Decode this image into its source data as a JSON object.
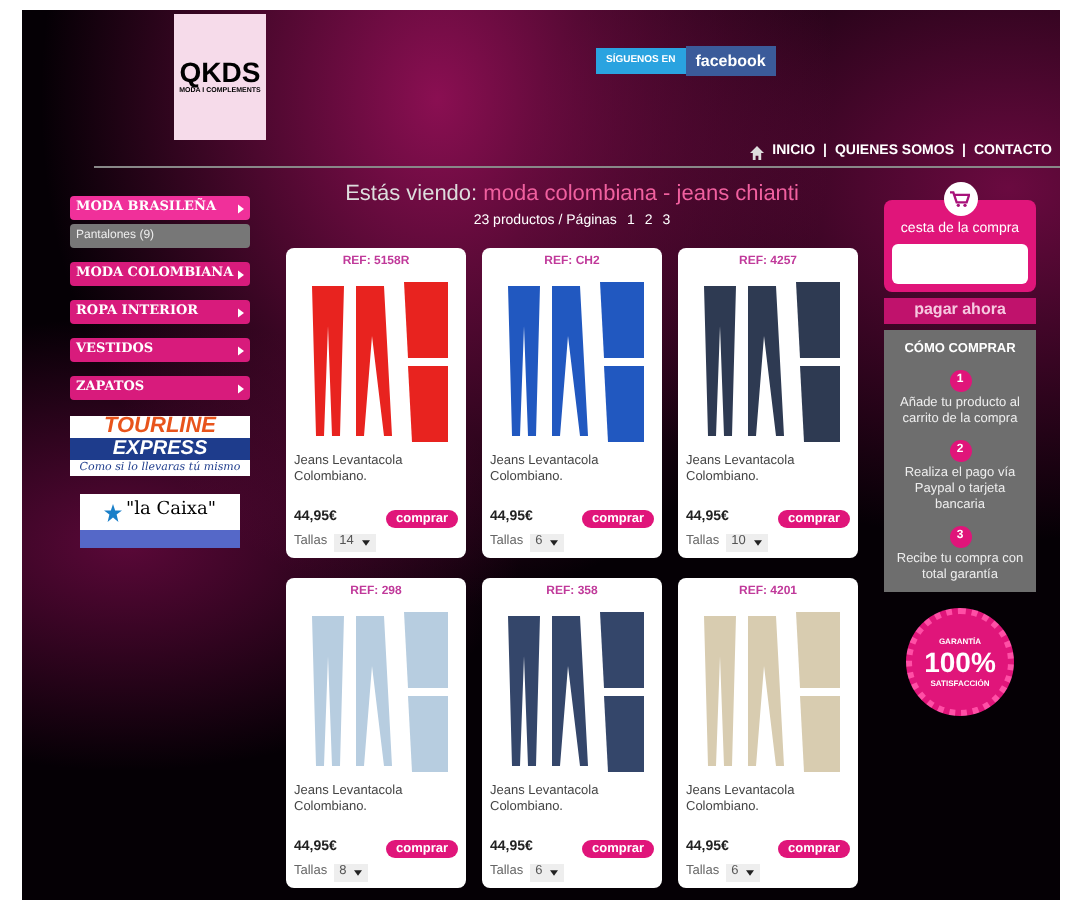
{
  "logo": {
    "name": "QKDS",
    "tagline": "MODA I COMPLEMENTS"
  },
  "social": {
    "label": "SÍGUENOS EN",
    "brand": "facebook"
  },
  "nav": [
    {
      "label": "INICIO",
      "kind": "home"
    },
    {
      "label": "QUIENES SOMOS",
      "kind": "link",
      "prefix": "|"
    },
    {
      "label": "CONTACTO",
      "kind": "link",
      "prefix": "|"
    }
  ],
  "sidebar": {
    "categories": [
      {
        "label": "MODA BRASILEÑA",
        "expanded": true,
        "children": [
          {
            "label": "Pantalones (9)"
          }
        ]
      },
      {
        "label": "MODA COLOMBIANA",
        "expanded": false
      },
      {
        "label": "ROPA INTERIOR",
        "expanded": false
      },
      {
        "label": "VESTIDOS",
        "expanded": false
      },
      {
        "label": "ZAPATOS",
        "expanded": false
      }
    ]
  },
  "partners": [
    {
      "kind": "tourline",
      "lines": [
        "TOURLINE",
        "EXPRESS",
        "Como si lo llevaras tú mismo"
      ]
    },
    {
      "kind": "lacaixa",
      "lines": [
        "\"la Caixa\""
      ]
    }
  ],
  "heading": {
    "prefix": "Estás viendo:",
    "category": "moda colombiana - jeans chianti"
  },
  "pagination": {
    "summary": "23 productos / Páginas",
    "pages": [
      {
        "label": "1"
      },
      {
        "label": "2"
      },
      {
        "label": "3"
      }
    ]
  },
  "products": [
    {
      "ref": "REF: 5158R",
      "color": "#e8231f",
      "title": "Jeans Levantacola Colombiano.",
      "price": "44,95€",
      "buy": "comprar",
      "sizes_label": "Tallas",
      "size": "14"
    },
    {
      "ref": "REF: CH2",
      "color": "#2158c0",
      "title": "Jeans Levantacola Colombiano.",
      "price": "44,95€",
      "buy": "comprar",
      "sizes_label": "Tallas",
      "size": "6"
    },
    {
      "ref": "REF: 4257",
      "color": "#2e3a52",
      "title": "Jeans Levantacola Colombiano.",
      "price": "44,95€",
      "buy": "comprar",
      "sizes_label": "Tallas",
      "size": "10"
    },
    {
      "ref": "REF: 298",
      "color": "#b7cde0",
      "title": "Jeans Levantacola Colombiano.",
      "price": "44,95€",
      "buy": "comprar",
      "sizes_label": "Tallas",
      "size": "8"
    },
    {
      "ref": "REF: 358",
      "color": "#34466a",
      "title": "Jeans Levantacola Colombiano.",
      "price": "44,95€",
      "buy": "comprar",
      "sizes_label": "Tallas",
      "size": "6"
    },
    {
      "ref": "REF: 4201",
      "color": "#d8ccb0",
      "title": "Jeans Levantacola Colombiano.",
      "price": "44,95€",
      "buy": "comprar",
      "sizes_label": "Tallas",
      "size": "6"
    }
  ],
  "cart": {
    "title": "cesta de la compra",
    "pay_button": "pagar ahora"
  },
  "how_to_buy": {
    "title": "CÓMO COMPRAR",
    "steps": [
      {
        "number": "1",
        "text": "Añade tu producto al carrito de la compra"
      },
      {
        "number": "2",
        "text": "Realiza el pago vía Paypal o tarjeta bancaria"
      },
      {
        "number": "3",
        "text": "Recibe tu compra con total garantía"
      }
    ]
  },
  "guarantee": {
    "top": "GARANTÍA",
    "value": "100%",
    "bottom": "SATISFACCIÓN"
  }
}
